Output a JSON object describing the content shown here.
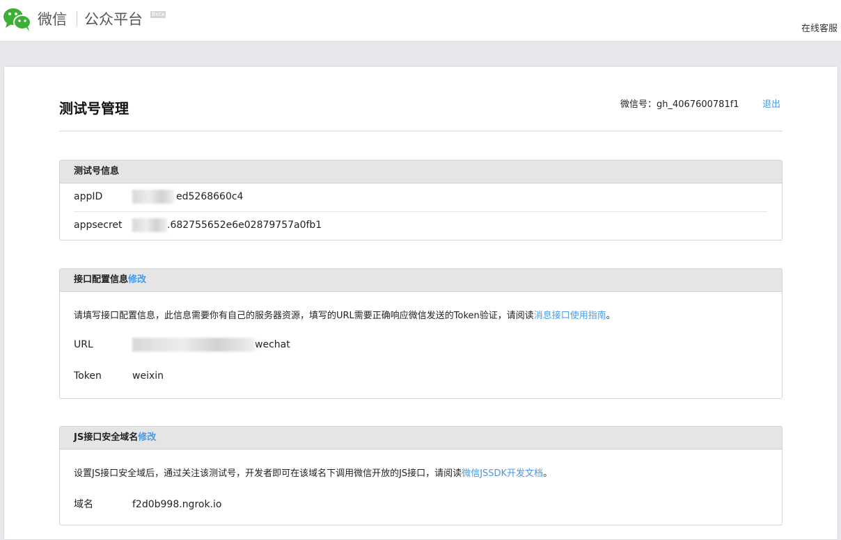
{
  "header": {
    "brand_weixin": "微信",
    "brand_platform": "公众平台",
    "beta": "Beta",
    "service": "在线客服"
  },
  "page": {
    "title": "测试号管理",
    "account_label": "微信号：",
    "account_id": "gh_4067600781f1",
    "logout": "退出"
  },
  "test_account": {
    "heading": "测试号信息",
    "appid_label": "appID",
    "appid_value": "ed5268660c4",
    "secret_label": "appsecret",
    "secret_value": ".682755652e6e02879757a0fb1"
  },
  "interface_config": {
    "heading": "接口配置信息",
    "edit": "修改",
    "desc_before": "请填写接口配置信息，此信息需要你有自己的服务器资源，填写的URL需要正确响应微信发送的Token验证，请阅读",
    "desc_link": "消息接口使用指南",
    "desc_after": "。",
    "url_label": "URL",
    "url_value": "wechat",
    "token_label": "Token",
    "token_value": "weixin"
  },
  "js_domain": {
    "heading": "JS接口安全域名",
    "edit": "修改",
    "desc_before": "设置JS接口安全域后，通过关注该测试号，开发者即可在该域名下调用微信开放的JS接口，请阅读",
    "desc_link": "微信JSSDK开发文档",
    "desc_after": "。",
    "domain_label": "域名",
    "domain_value": "f2d0b998.ngrok.io"
  },
  "colors": {
    "link": "#459ae9",
    "wechat_green": "#3cb034",
    "panel_header": "#e5e5e5"
  }
}
